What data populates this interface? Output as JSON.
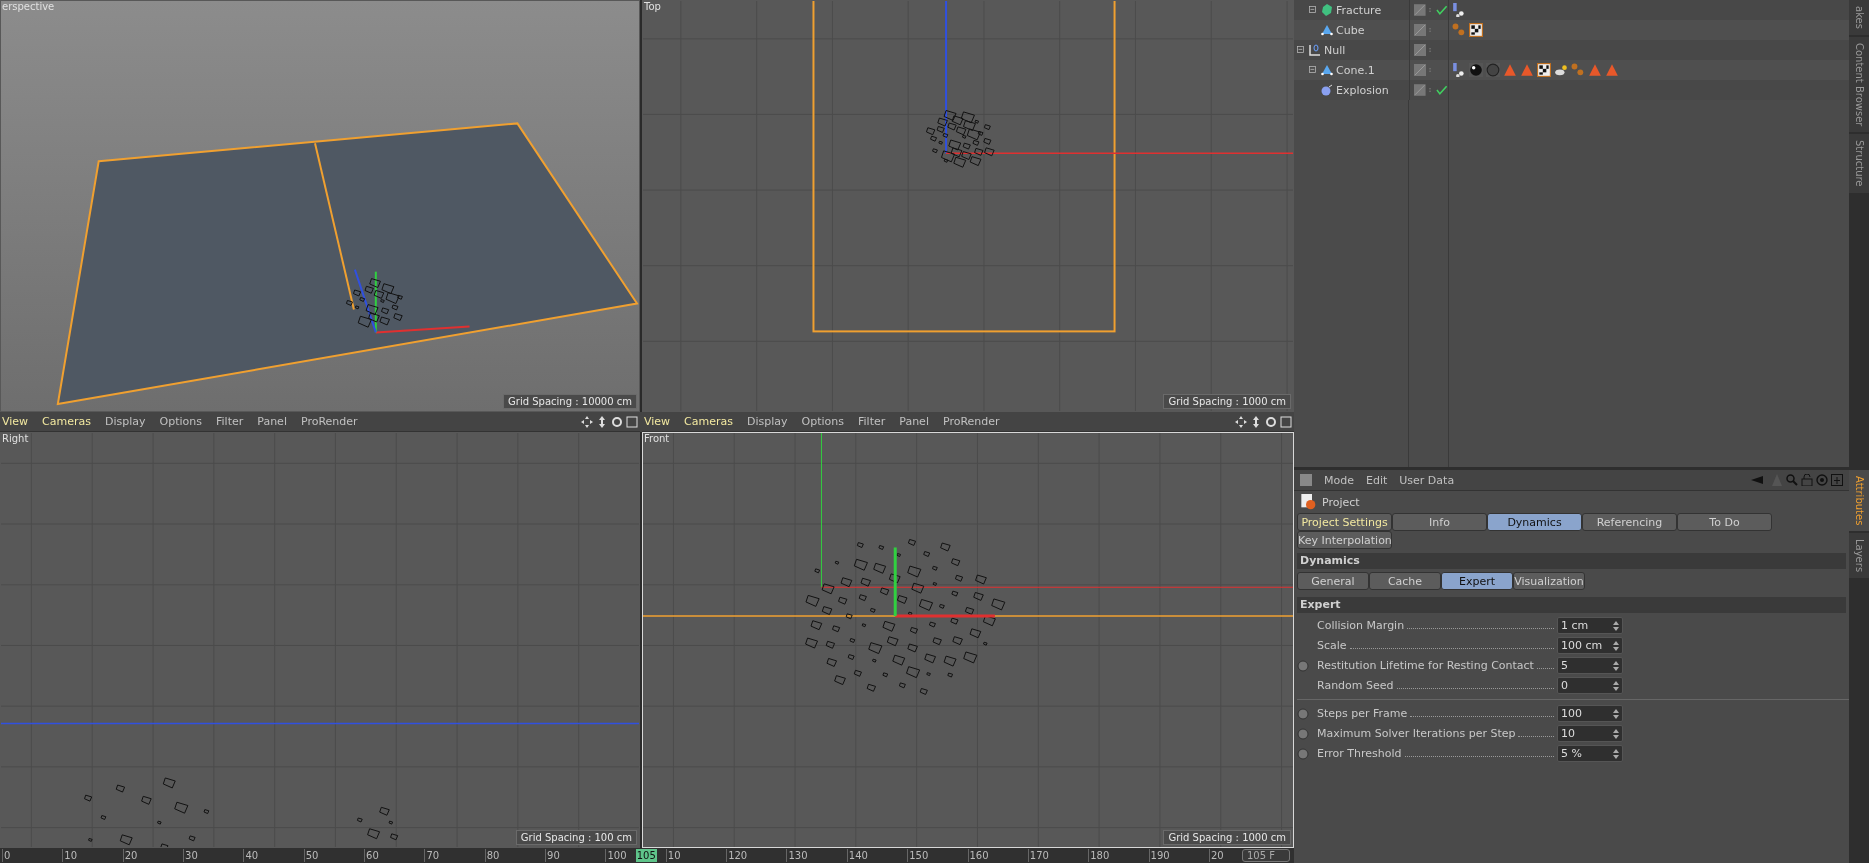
{
  "viewports": [
    {
      "kind": "perspective",
      "label": "erspective",
      "grid_spacing": "Grid Spacing : 10000 cm",
      "active": false
    },
    {
      "kind": "top",
      "label": "Top",
      "grid_spacing": "Grid Spacing : 1000 cm",
      "active": false
    },
    {
      "kind": "right",
      "label": "Right",
      "grid_spacing": "Grid Spacing : 100 cm",
      "active": false,
      "menu": [
        "View",
        "Cameras",
        "Display",
        "Options",
        "Filter",
        "Panel",
        "ProRender"
      ]
    },
    {
      "kind": "front",
      "label": "Front",
      "grid_spacing": "Grid Spacing : 1000 cm",
      "active": true,
      "menu": [
        "View",
        "Cameras",
        "Display",
        "Options",
        "Filter",
        "Panel",
        "ProRender"
      ]
    }
  ],
  "timeline": {
    "ticks": [
      "0",
      "10",
      "20",
      "30",
      "40",
      "50",
      "60",
      "70",
      "80",
      "90",
      "100",
      "10",
      "120",
      "130",
      "140",
      "150",
      "160",
      "170",
      "180",
      "190",
      "20"
    ],
    "current": "105",
    "frame_field": "105 F"
  },
  "object_manager": {
    "tree": [
      {
        "children": [
          {
            "name": "Fracture",
            "kind": "fracture",
            "expanded": true,
            "enabled": true,
            "tags": [
              {
                "kind": "dynamics"
              }
            ],
            "children": [
              {
                "name": "Cube",
                "kind": "primitive",
                "enabled": false,
                "tags": [
                  {
                    "kind": "particles"
                  },
                  {
                    "kind": "texture"
                  }
                ]
              }
            ]
          }
        ]
      },
      {
        "name": "Null",
        "kind": "null",
        "expanded": true,
        "enabled": false,
        "children": [
          {
            "name": "Cone.1",
            "kind": "primitive",
            "expanded": true,
            "enabled": false,
            "tags": [
              {
                "kind": "dynamics"
              },
              {
                "kind": "chrome"
              },
              {
                "kind": "sphere"
              },
              {
                "kind": "cone"
              },
              {
                "kind": "cone"
              },
              {
                "kind": "texture"
              },
              {
                "kind": "explosion"
              },
              {
                "kind": "particles"
              },
              {
                "kind": "cone"
              },
              {
                "kind": "cone"
              }
            ],
            "children": [
              {
                "name": "Explosion",
                "kind": "explosion",
                "enabled": true
              }
            ]
          }
        ]
      }
    ]
  },
  "side_tabs_top": [
    {
      "label": "akes",
      "selected": false
    },
    {
      "label": "Content Browser",
      "selected": false
    },
    {
      "label": "Structure",
      "selected": false
    }
  ],
  "side_tabs_bottom": [
    {
      "label": "Attributes",
      "selected": true
    },
    {
      "label": "Layers",
      "selected": false
    }
  ],
  "attributes": {
    "menu": [
      "Mode",
      "Edit",
      "User Data"
    ],
    "object": "Project",
    "tabs": [
      {
        "label": "Project Settings",
        "selected": false,
        "highlighted": true
      },
      {
        "label": "Info",
        "selected": false,
        "highlighted": false
      },
      {
        "label": "Dynamics",
        "selected": true,
        "highlighted": false
      },
      {
        "label": "Referencing",
        "selected": false,
        "highlighted": false
      },
      {
        "label": "To Do",
        "selected": false,
        "highlighted": false
      },
      {
        "label": "Key Interpolation",
        "selected": false,
        "highlighted": false
      }
    ],
    "section": "Dynamics",
    "subtabs": [
      {
        "label": "General",
        "selected": false
      },
      {
        "label": "Cache",
        "selected": false
      },
      {
        "label": "Expert",
        "selected": true
      },
      {
        "label": "Visualization",
        "selected": false
      }
    ],
    "group": "Expert",
    "params": [
      {
        "label": "Collision Margin",
        "value": "1 cm",
        "animatable": false
      },
      {
        "label": "Scale",
        "value": "100 cm",
        "animatable": false
      },
      {
        "label": "Restitution Lifetime for Resting Contact",
        "value": "5",
        "animatable": true
      },
      {
        "label": "Random Seed",
        "value": "0",
        "animatable": false
      }
    ],
    "params2": [
      {
        "label": "Steps per Frame",
        "value": "100",
        "animatable": true
      },
      {
        "label": "Maximum Solver Iterations per Step",
        "value": "10",
        "animatable": true
      },
      {
        "label": "Error Threshold",
        "value": "5 %",
        "animatable": true
      }
    ]
  }
}
